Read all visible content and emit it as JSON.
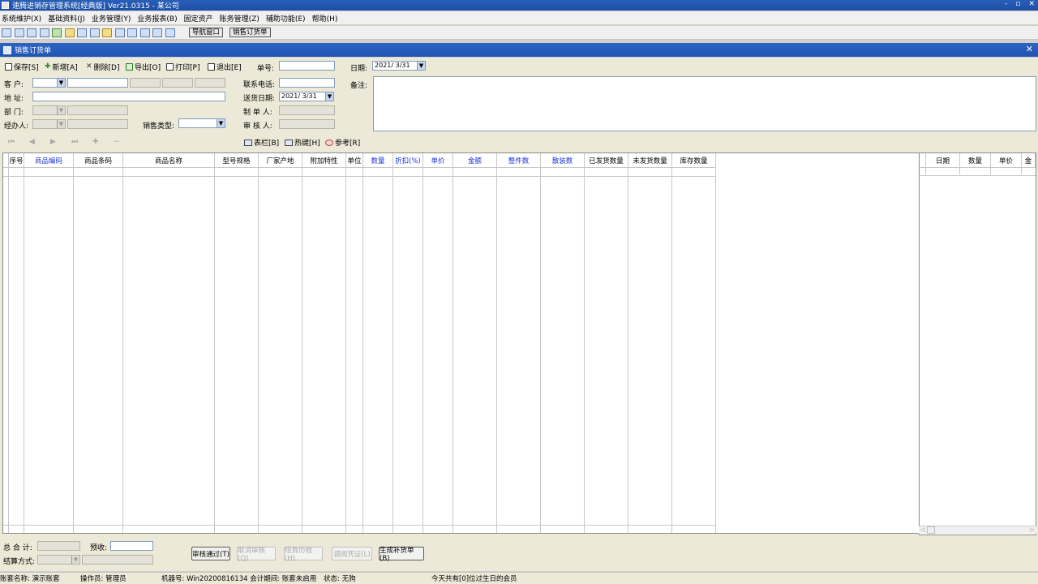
{
  "window": {
    "title": "速腾进销存管理系统[经典版] Ver21.0315 - 某公司",
    "buttons": [
      "-",
      "▫",
      "✕"
    ]
  },
  "menu": [
    "系统维护(X)",
    "基础资料(J)",
    "业务管理(Y)",
    "业务报表(B)",
    "固定资产",
    "账务管理(Z)",
    "辅助功能(E)",
    "帮助(H)"
  ],
  "toolbar": {
    "nav_button": "导航窗口",
    "order_button": "销售订货单"
  },
  "subwindow": {
    "title": "销售订货单"
  },
  "commands": {
    "save": "保存[S]",
    "add": "新增[A]",
    "delete": "删除[D]",
    "export": "导出[O]",
    "print": "打印[P]",
    "exit": "退出[E]"
  },
  "form": {
    "order_no_label": "单号:",
    "order_no_value": "",
    "date_label": "日期:",
    "date_value": "2021/ 3/31",
    "customer_label": "客  户:",
    "address_label": "地  址:",
    "dept_label": "部  门:",
    "handler_label": "经办人:",
    "sales_type_label": "销售类型:",
    "phone_label": "联系电话:",
    "delivery_date_label": "送货日期:",
    "delivery_date_value": "2021/ 3/31",
    "maker_label": "制 单 人:",
    "reviewer_label": "审 核 人:",
    "remark_label": "备注:"
  },
  "grid_tools": {
    "columns": "表栏[B]",
    "hotkeys": "热键[H]",
    "reference": "参考[R]"
  },
  "main_columns": [
    {
      "label": "序号",
      "blue": false
    },
    {
      "label": "商品编码",
      "blue": true
    },
    {
      "label": "商品条码",
      "blue": false
    },
    {
      "label": "商品名称",
      "blue": false
    },
    {
      "label": "型号规格",
      "blue": false
    },
    {
      "label": "厂家产地",
      "blue": false
    },
    {
      "label": "附加特性",
      "blue": false
    },
    {
      "label": "单位",
      "blue": false
    },
    {
      "label": "数量",
      "blue": true
    },
    {
      "label": "折扣(%)",
      "blue": true
    },
    {
      "label": "单价",
      "blue": true
    },
    {
      "label": "金额",
      "blue": true
    },
    {
      "label": "整件数",
      "blue": true
    },
    {
      "label": "散装数",
      "blue": true
    },
    {
      "label": "已发货数量",
      "blue": false
    },
    {
      "label": "未发货数量",
      "blue": false
    },
    {
      "label": "库存数量",
      "blue": false
    }
  ],
  "side_columns": [
    "日期",
    "数量",
    "单价",
    "金"
  ],
  "footer": {
    "total_label": "总 合 计:",
    "prepay_label": "预收:",
    "settle_label": "结算方式:",
    "buttons": [
      {
        "label": "审核通过(T)",
        "enabled": true
      },
      {
        "label": "取消审核(Q)",
        "enabled": false
      },
      {
        "label": "结算历程(H)",
        "enabled": false
      },
      {
        "label": "调阅凭证(L)",
        "enabled": false
      },
      {
        "label": "生成补货单(B)",
        "enabled": true
      }
    ]
  },
  "status": {
    "account": "账套名称: 演示账套",
    "operator": "操作员: 管理员",
    "machine": "机器号: Win20200816134 会计期间: 账套未启用",
    "state": "状态: 无狗",
    "birthday": "今天共有[0]位过生日的会员"
  },
  "colors": {
    "title_blue": "#1f54b2",
    "header_blue_text": "#1a34d6",
    "form_bg": "#ece9d8"
  }
}
